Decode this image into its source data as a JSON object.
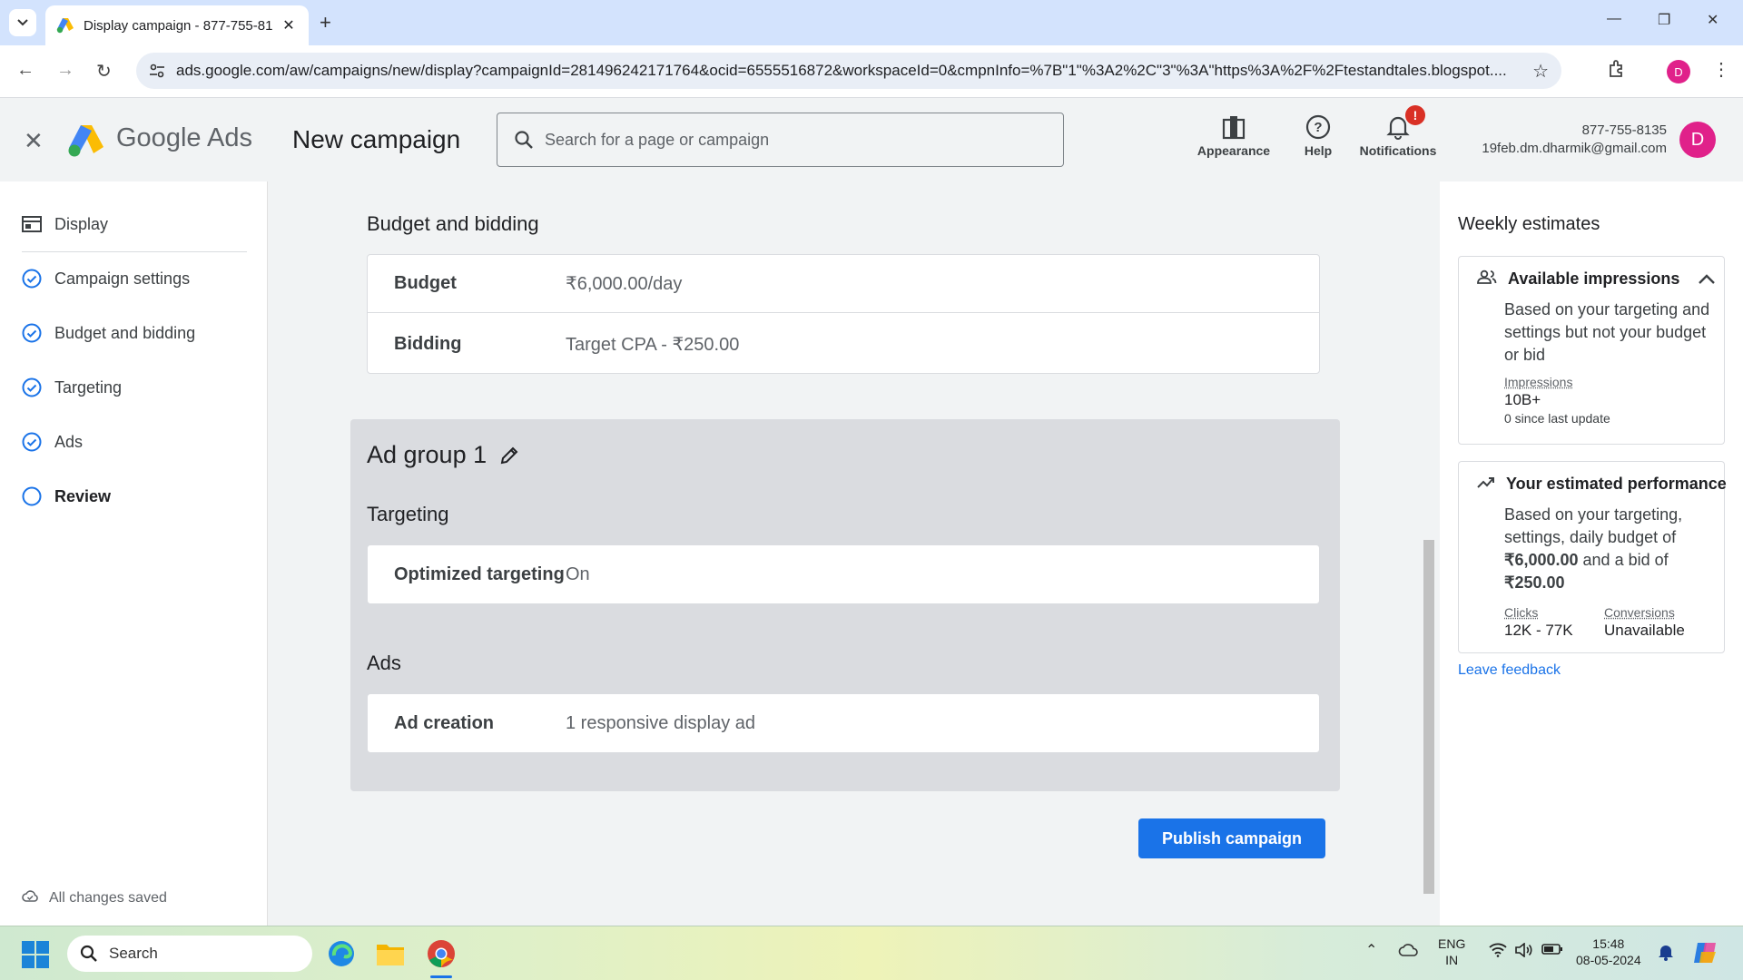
{
  "browser": {
    "tab_title": "Display campaign - 877-755-81",
    "url": "ads.google.com/aw/campaigns/new/display?campaignId=281496242171764&ocid=6555516872&workspaceId=0&cmpnInfo=%7B\"1\"%3A2%2C\"3\"%3A\"https%3A%2F%2Ftestandtales.blogspot....",
    "profile_initial": "D"
  },
  "header": {
    "brand": "Google Ads",
    "page_title": "New campaign",
    "search_placeholder": "Search for a page or campaign",
    "appearance_label": "Appearance",
    "help_label": "Help",
    "notifications_label": "Notifications",
    "notifications_badge": "!",
    "account_phone": "877-755-8135",
    "account_email": "19feb.dm.dharmik@gmail.com",
    "avatar_initial": "D"
  },
  "sidebar": {
    "items": [
      {
        "label": "Display"
      },
      {
        "label": "Campaign settings"
      },
      {
        "label": "Budget and bidding"
      },
      {
        "label": "Targeting"
      },
      {
        "label": "Ads"
      },
      {
        "label": "Review"
      }
    ],
    "saved_status": "All changes saved"
  },
  "main": {
    "budget_section_title": "Budget and bidding",
    "budget_label": "Budget",
    "budget_value": "₹6,000.00/day",
    "bidding_label": "Bidding",
    "bidding_value": "Target CPA - ₹250.00",
    "ad_group_title": "Ad group 1",
    "targeting_title": "Targeting",
    "optimized_label": "Optimized targeting",
    "optimized_value": "On",
    "ads_title": "Ads",
    "ad_creation_label": "Ad creation",
    "ad_creation_value": "1 responsive display ad",
    "publish_label": "Publish campaign"
  },
  "estimates": {
    "title": "Weekly estimates",
    "impressions": {
      "heading": "Available impressions",
      "desc": "Based on your targeting and settings but not your budget or bid",
      "label": "Impressions",
      "value": "10B+",
      "note": "0 since last update"
    },
    "performance": {
      "heading": "Your estimated performance",
      "desc_1": "Based on your targeting, settings, daily budget of",
      "budget": "₹6,000.00",
      "desc_2": " and a bid of",
      "bid": "₹250.00",
      "clicks_label": "Clicks",
      "clicks_value": "12K - 77K",
      "conversions_label": "Conversions",
      "conversions_value": "Unavailable"
    },
    "feedback": "Leave feedback"
  },
  "taskbar": {
    "search_placeholder": "Search",
    "lang_1": "ENG",
    "lang_2": "IN",
    "time": "15:48",
    "date": "08-05-2024"
  },
  "colors": {
    "accent": "#1a73e8",
    "avatar": "#e0218a",
    "badge": "#d93025"
  }
}
